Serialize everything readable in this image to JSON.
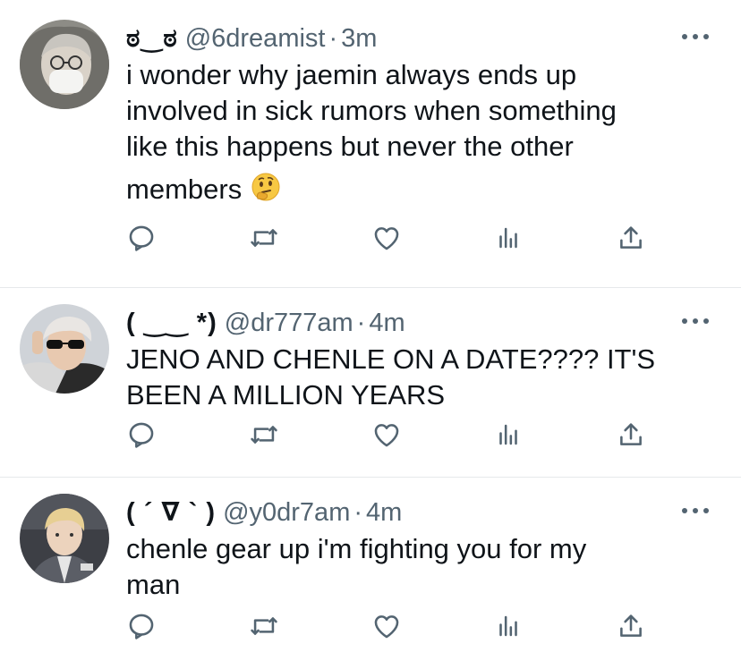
{
  "tweets": [
    {
      "name": "ಠ‿ಠ",
      "handle": "@6dreamist",
      "separator": "·",
      "time": "3m",
      "lines": [
        "i wonder why jaemin always ends up",
        "involved in sick rumors when something",
        "like this happens but never the other",
        "members"
      ],
      "emoji": "thinking-face-emoji",
      "avatar": "avatar-gray-hoodie-mask"
    },
    {
      "name": "( ‿‿ *)",
      "handle": "@dr777am",
      "separator": "·",
      "time": "4m",
      "lines": [
        "JENO AND CHENLE ON A DATE???? IT'S",
        "BEEN A MILLION YEARS"
      ],
      "avatar": "avatar-sunglasses"
    },
    {
      "name": "( ´ ∇ ` )",
      "handle": "@y0dr7am",
      "separator": "·",
      "time": "4m",
      "lines": [
        "chenle gear up i'm fighting you for my",
        "man"
      ],
      "avatar": "avatar-suit"
    }
  ],
  "icons": {
    "reply": "reply-icon",
    "retweet": "retweet-icon",
    "like": "like-icon",
    "analytics": "analytics-icon",
    "share": "share-icon",
    "more": "more-options-icon"
  },
  "colors": {
    "text": "#0f1419",
    "secondary": "#536471",
    "divider": "#e6e9eb"
  }
}
